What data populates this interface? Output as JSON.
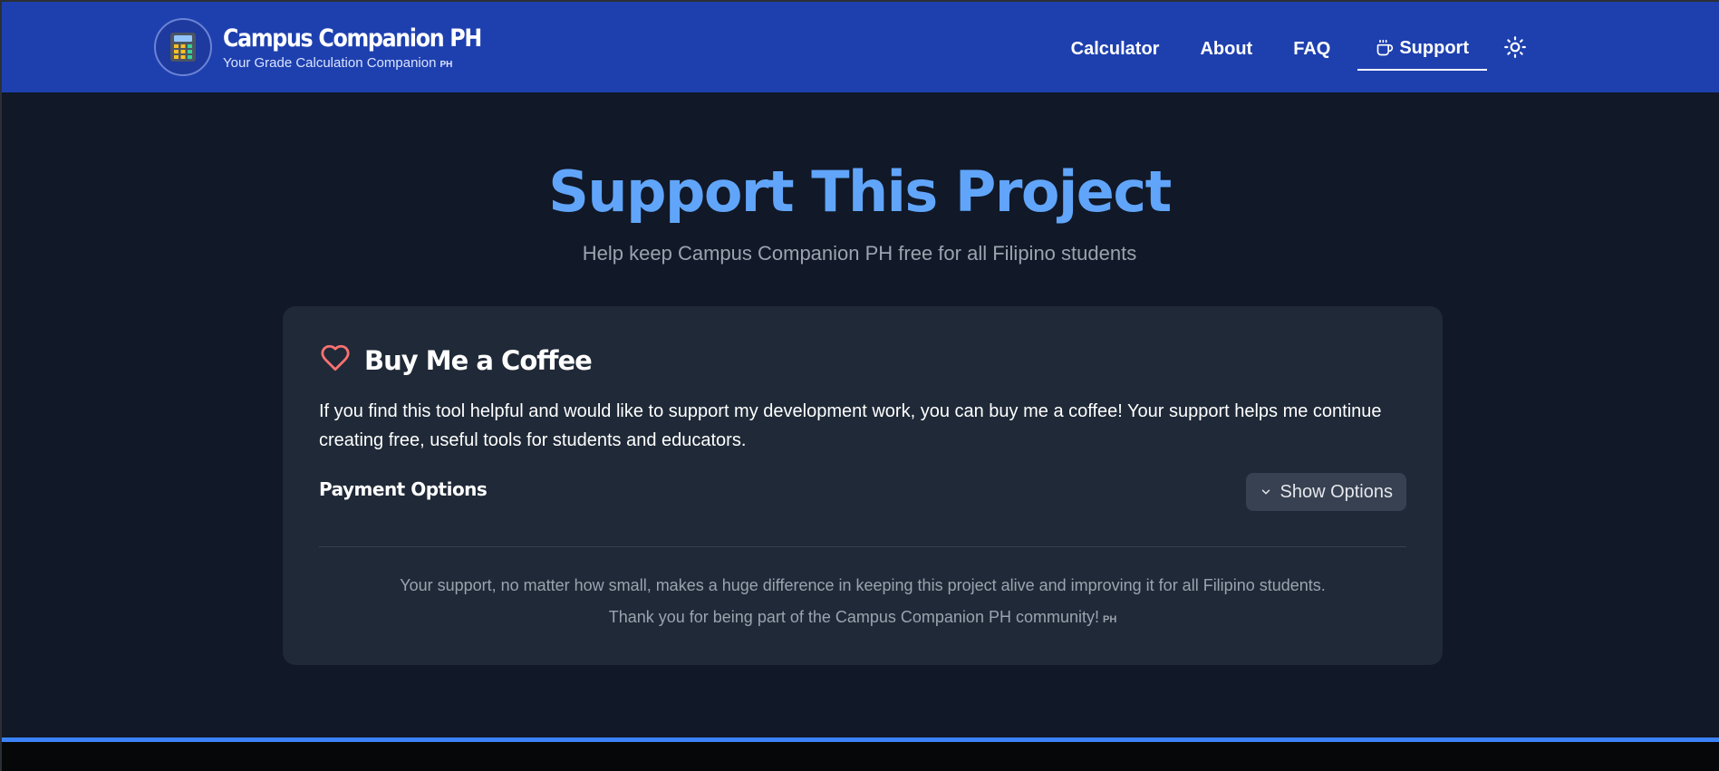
{
  "header": {
    "brand_title": "Campus Companion PH",
    "brand_subtitle": "Your Grade Calculation Companion",
    "brand_flag": "PH",
    "nav": {
      "calculator": "Calculator",
      "about": "About",
      "faq": "FAQ",
      "support": "Support"
    },
    "icons": {
      "logo": "calculator-icon",
      "support": "coffee-cup-icon",
      "theme": "sun-icon"
    }
  },
  "hero": {
    "title": "Support This Project",
    "subtitle": "Help keep Campus Companion PH free for all Filipino students"
  },
  "card": {
    "title": "Buy Me a Coffee",
    "icon": "heart-icon",
    "description": "If you find this tool helpful and would like to support my development work, you can buy me a coffee! Your support helps me continue creating free, useful tools for students and educators.",
    "payment_label": "Payment Options",
    "show_button": "Show Options",
    "footer_line1": "Your support, no matter how small, makes a huge difference in keeping this project alive and improving it for all Filipino students.",
    "footer_line2": "Thank you for being part of the Campus Companion PH community!",
    "footer_flag": "PH"
  },
  "colors": {
    "header_bg": "#1e40af",
    "page_bg": "#111827",
    "card_bg": "#1f2937",
    "accent": "#60a5fa",
    "heart": "#f87171"
  }
}
